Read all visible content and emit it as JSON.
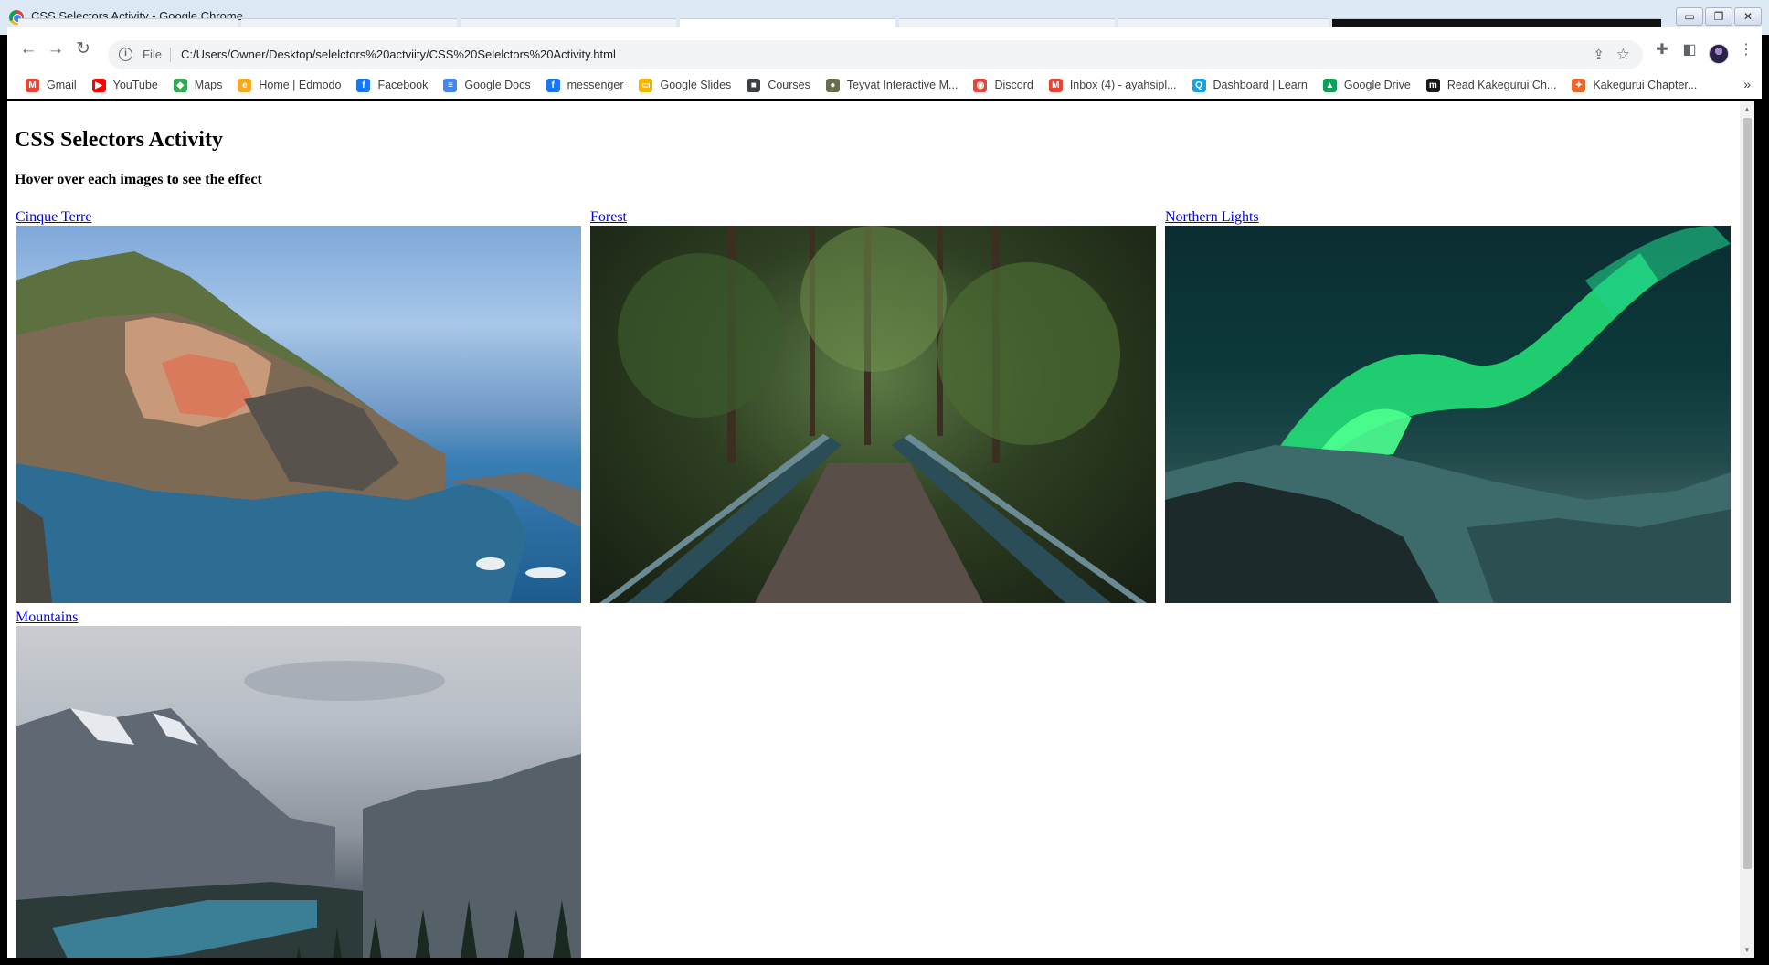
{
  "window": {
    "title": "CSS Selectors Activity - Google Chrome"
  },
  "toolbar": {
    "scheme_label": "File",
    "url": "C:/Users/Owner/Desktop/selelctors%20actviity/CSS%20Selelctors%20Activity.html"
  },
  "bookmarks": [
    {
      "label": "Gmail",
      "icon": "gmail-icon",
      "color": "#ea4335"
    },
    {
      "label": "YouTube",
      "icon": "youtube-icon",
      "color": "#ff0000"
    },
    {
      "label": "Maps",
      "icon": "maps-icon",
      "color": "#34a853"
    },
    {
      "label": "Home | Edmodo",
      "icon": "edmodo-icon",
      "color": "#f5a623"
    },
    {
      "label": "Facebook",
      "icon": "facebook-icon",
      "color": "#1877f2"
    },
    {
      "label": "Google Docs",
      "icon": "docs-icon",
      "color": "#4285f4"
    },
    {
      "label": "messenger",
      "icon": "facebook-icon",
      "color": "#1877f2"
    },
    {
      "label": "Google Slides",
      "icon": "slides-icon",
      "color": "#f4b400"
    },
    {
      "label": "Courses",
      "icon": "courses-icon",
      "color": "#3c4043"
    },
    {
      "label": "Teyvat Interactive M...",
      "icon": "teyvat-icon",
      "color": "#6b6b50"
    },
    {
      "label": "Discord",
      "icon": "discord-icon",
      "color": "#e8453c"
    },
    {
      "label": "Inbox (4) - ayahsipl...",
      "icon": "gmail-icon",
      "color": "#ea4335"
    },
    {
      "label": "Dashboard | Learn",
      "icon": "learn-icon",
      "color": "#1ba1e2"
    },
    {
      "label": "Google Drive",
      "icon": "drive-icon",
      "color": "#0f9d58"
    },
    {
      "label": "Read Kakegurui Ch...",
      "icon": "manga-icon",
      "color": "#1a1a1a"
    },
    {
      "label": "Kakegurui Chapter...",
      "icon": "kakegurui-icon",
      "color": "#e8672c"
    }
  ],
  "page": {
    "heading": "CSS Selectors Activity",
    "subheading": "Hover over each images to see the effect",
    "gallery": [
      {
        "caption": "Cinque Terre",
        "image": "coastal-village-photo"
      },
      {
        "caption": "Forest",
        "image": "forest-bridge-photo"
      },
      {
        "caption": "Northern Lights",
        "image": "aurora-photo"
      },
      {
        "caption": "Mountains",
        "image": "mountain-lake-photo"
      }
    ]
  }
}
